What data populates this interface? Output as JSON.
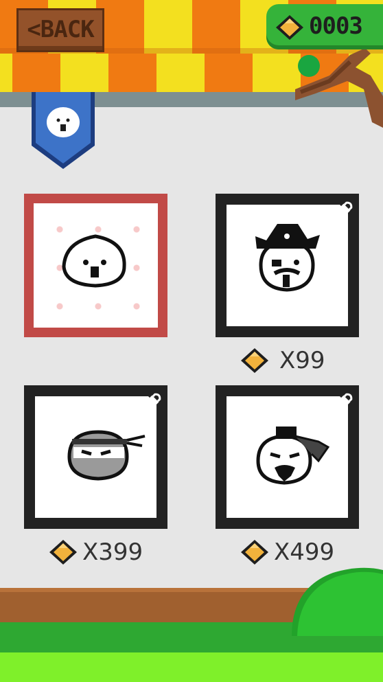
{
  "header": {
    "back_label": "BACK",
    "coin_count": "0003"
  },
  "colors": {
    "awning_orange": "#f07a12",
    "awning_yellow": "#f3e01f",
    "selected_border": "#c14a47",
    "locked_border": "#222222",
    "coin": "#f2b23c",
    "counter_green": "#35b33a"
  },
  "characters": [
    {
      "name": "plain",
      "selected": true,
      "locked": false,
      "price": ""
    },
    {
      "name": "pirate",
      "selected": false,
      "locked": true,
      "price": "X99"
    },
    {
      "name": "ninja",
      "selected": false,
      "locked": true,
      "price": "X399"
    },
    {
      "name": "samurai",
      "selected": false,
      "locked": true,
      "price": "X499"
    }
  ]
}
